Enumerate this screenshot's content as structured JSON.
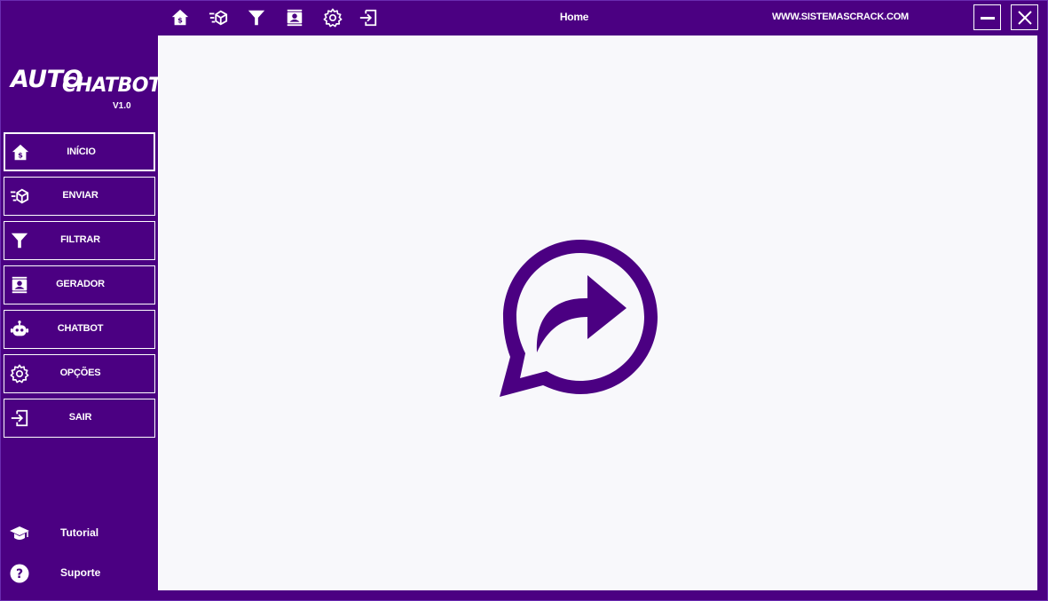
{
  "header": {
    "title": "Home",
    "website": "WWW.SISTEMASCRACK.COM",
    "toolbar_icons": [
      "home-dollar-icon",
      "send-box-icon",
      "filter-icon",
      "contact-card-icon",
      "gear-icon",
      "exit-icon"
    ],
    "window_controls": [
      "minimize-icon",
      "close-icon"
    ]
  },
  "logo": {
    "line1": "AUTO",
    "line2": "CHATBOT",
    "version": "V1.0"
  },
  "sidebar": {
    "items": [
      {
        "label": "INÍCIO",
        "icon": "home-dollar-icon",
        "active": true
      },
      {
        "label": "ENVIAR",
        "icon": "send-box-icon",
        "active": false
      },
      {
        "label": "FILTRAR",
        "icon": "filter-icon",
        "active": false
      },
      {
        "label": "GERADOR",
        "icon": "contact-card-icon",
        "active": false
      },
      {
        "label": "CHATBOT",
        "icon": "robot-icon",
        "active": false
      },
      {
        "label": "OPÇÕES",
        "icon": "gear-icon",
        "active": false
      },
      {
        "label": "SAIR",
        "icon": "exit-icon",
        "active": false
      }
    ],
    "bottom_links": [
      {
        "label": "Tutorial",
        "icon": "graduation-cap-icon"
      },
      {
        "label": "Suporte",
        "icon": "question-circle-icon"
      }
    ]
  },
  "main": {
    "hero_icon": "chat-share-bubble-icon"
  },
  "colors": {
    "brand": "#4b0082",
    "panel": "#f8f8fb",
    "text": "#ffffff"
  }
}
